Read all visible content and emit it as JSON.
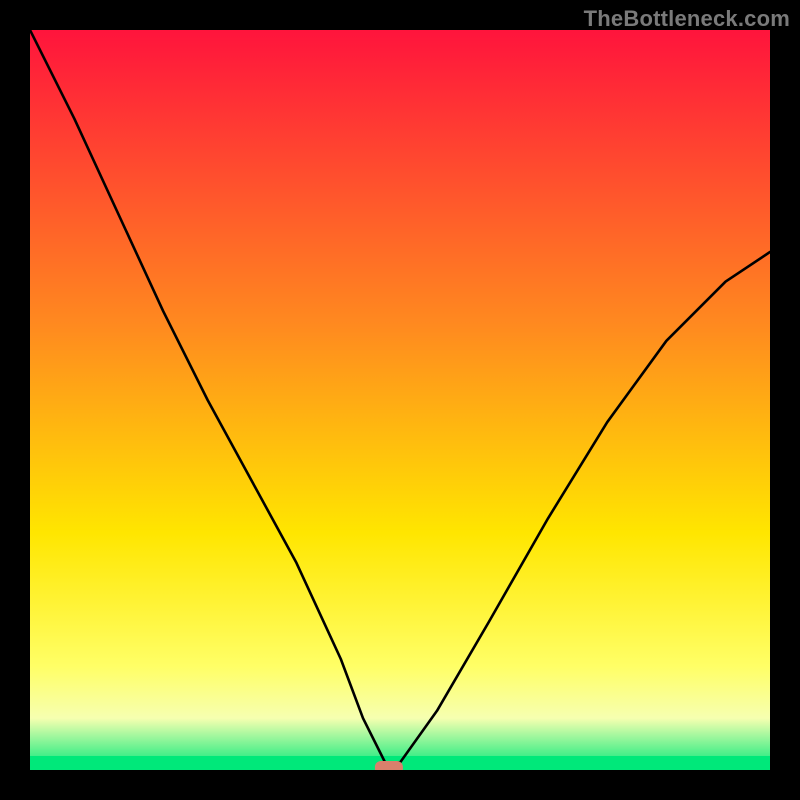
{
  "watermark": "TheBottleneck.com",
  "colors": {
    "top": "#ff143c",
    "mid": "#ffe600",
    "band": "#f6ffb0",
    "green": "#00e87a",
    "curve": "#000000",
    "marker": "#d9806c"
  },
  "chart_data": {
    "type": "line",
    "title": "",
    "xlabel": "",
    "ylabel": "",
    "xlim": [
      0,
      100
    ],
    "ylim": [
      0,
      100
    ],
    "series": [
      {
        "name": "bottleneck-curve",
        "x": [
          0,
          6,
          12,
          18,
          24,
          30,
          36,
          42,
          45,
          48,
          50,
          55,
          62,
          70,
          78,
          86,
          94,
          100
        ],
        "values": [
          100,
          88,
          75,
          62,
          50,
          39,
          28,
          15,
          7,
          1,
          1,
          8,
          20,
          34,
          47,
          58,
          66,
          70
        ]
      }
    ],
    "annotations": [
      {
        "name": "min-marker",
        "x": 48.5,
        "y": 0,
        "shape": "round-rect",
        "color": "#d9806c"
      }
    ]
  }
}
